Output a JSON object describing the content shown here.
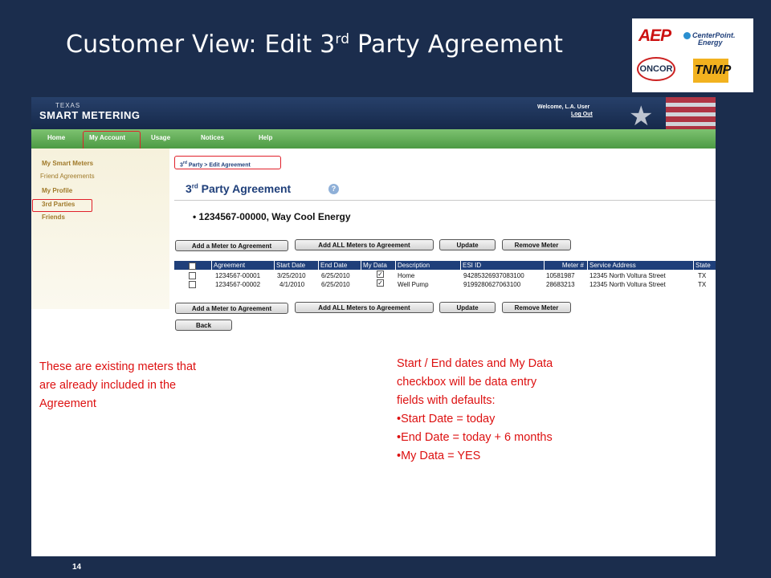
{
  "slide": {
    "title_prefix": "Customer View:  Edit 3",
    "title_sup": "rd",
    "title_suffix": " Party Agreement",
    "page_number": "14"
  },
  "logos": {
    "aep": "AEP",
    "centerpoint_line1": "CenterPoint.",
    "centerpoint_line2": "Energy",
    "oncor": "ONCOR",
    "tnmp": "TNMP"
  },
  "app": {
    "brand_small": "TEXAS",
    "brand": "SMART METERING",
    "welcome": "Welcome, L.A. User",
    "logout": "Log Out"
  },
  "nav": {
    "items": [
      "Home",
      "My Account",
      "Usage",
      "Notices",
      "Help"
    ]
  },
  "sidebar": {
    "my_smart_meters": "My Smart Meters",
    "friend_agreements": "Friend Agreements",
    "my_profile": "My Profile",
    "third_parties": "3rd Parties",
    "friends": "Friends"
  },
  "breadcrumb": {
    "pre": "3",
    "sup": "rd",
    "post": " Party > Edit Agreement"
  },
  "heading": {
    "pre": "3",
    "sup": "rd",
    "post": " Party Agreement",
    "help": "?"
  },
  "agreement_line": "• 1234567-00000, Way Cool Energy",
  "buttons": {
    "add_meter": "Add a Meter to Agreement",
    "add_all": "Add ALL Meters to Agreement",
    "update": "Update",
    "remove": "Remove Meter",
    "back": "Back"
  },
  "table": {
    "columns": [
      "Agreement",
      "Start Date",
      "End Date",
      "My Data",
      "Description",
      "ESI ID",
      "Meter #",
      "Service Address",
      "State"
    ],
    "rows": [
      {
        "agreement": "1234567-00001",
        "start": "3/25/2010",
        "end": "6/25/2010",
        "my_data": "✓",
        "description": "Home",
        "esi_id": "942853269370831​00",
        "meter": "10581987",
        "address": "12345 North Voltura Street",
        "state": "TX"
      },
      {
        "agreement": "1234567-00002",
        "start": "4/1/2010",
        "end": "6/25/2010",
        "my_data": "✓",
        "description": "Well Pump",
        "esi_id": "91992806270631​00",
        "meter": "28683213",
        "address": "12345 North Voltura Street",
        "state": "TX"
      }
    ]
  },
  "notes": {
    "left": [
      "These are existing meters that",
      "are already included in the",
      "Agreement"
    ],
    "right": [
      "Start / End dates and My Data",
      "checkbox will be data entry",
      "fields with defaults:",
      "•Start Date = today",
      "•End Date = today + 6 months",
      "•My Data = YES"
    ]
  },
  "colors": {
    "slide_background": "#1b2d4d",
    "annotation_red": "#dd1111",
    "nav_green": "#4c9a43",
    "table_header_blue": "#1f3f7a"
  }
}
